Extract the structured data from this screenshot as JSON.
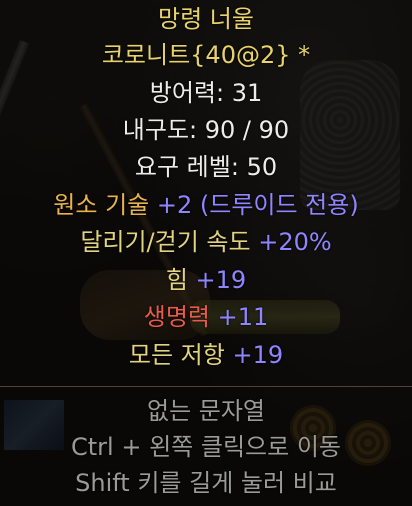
{
  "item": {
    "name": "망령 너울",
    "base_type": "코로니트{40@2} *",
    "defense_label": "방어력: ",
    "defense_value": "31",
    "durability_label": "내구도: ",
    "durability_value": "90 / 90",
    "requirement_label": "요구 레벨: ",
    "requirement_value": "50"
  },
  "mods": [
    {
      "label": "원소 기술",
      "value": " +2 (드루이드 전용)"
    },
    {
      "label": "달리기/걷기 속도",
      "value": " +20%"
    },
    {
      "label": "힘",
      "value": " +19"
    },
    {
      "label": "생명력",
      "value": " +11"
    },
    {
      "label": "모든 저항",
      "value": " +19"
    }
  ],
  "footer": {
    "no_string": "없는 문자열",
    "ctrl_hint": "Ctrl + 왼쪽 클릭으로 이동",
    "shift_hint": "Shift 키를 길게 눌러 비교"
  },
  "colors": {
    "unique_name": "#e8d36a",
    "base_text": "#ececec",
    "class_skill_label": "#e8b34a",
    "magic_value": "#8f86ff",
    "stat_label": "#e3d27e",
    "life_label": "#e85a4c",
    "hint_text": "#9a9a9a"
  }
}
